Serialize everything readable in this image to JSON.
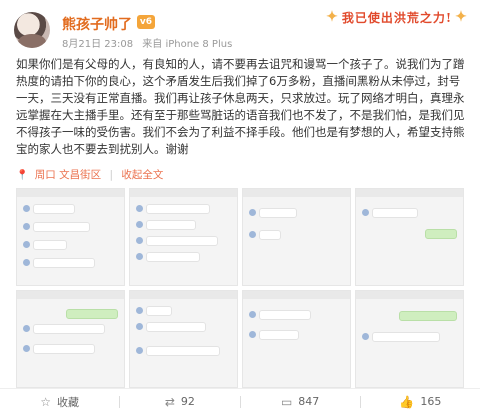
{
  "post": {
    "username": "熊孩子帅了",
    "badge": "v6",
    "date": "8月21日 23:08",
    "source": "来自 iPhone 8 Plus",
    "banner": "我已使出洪荒之力!",
    "text": "如果你们是有父母的人，有良知的人，请不要再去诅咒和谩骂一个孩子了。说我们为了蹭热度的请拍下你的良心，这个矛盾发生后我们掉了6万多粉，直播间黑粉从未停过，封号一天，三天没有正常直播。我们再让孩子休息两天，只求放过。玩了网络才明白，真理永远掌握在大主播手里。还有至于那些骂脏话的语音我们也不发了，不是我们怕，是我们见不得孩子一味的受伤害。我们不会为了利益不择手段。他们也是有梦想的人，希望支持熊宝的家人也不要去到扰别人。谢谢",
    "location": "周口",
    "district": "文昌街区",
    "expand": "收起全文"
  },
  "actions": {
    "collect": "收藏",
    "repost": "92",
    "comment": "847",
    "like": "165"
  }
}
